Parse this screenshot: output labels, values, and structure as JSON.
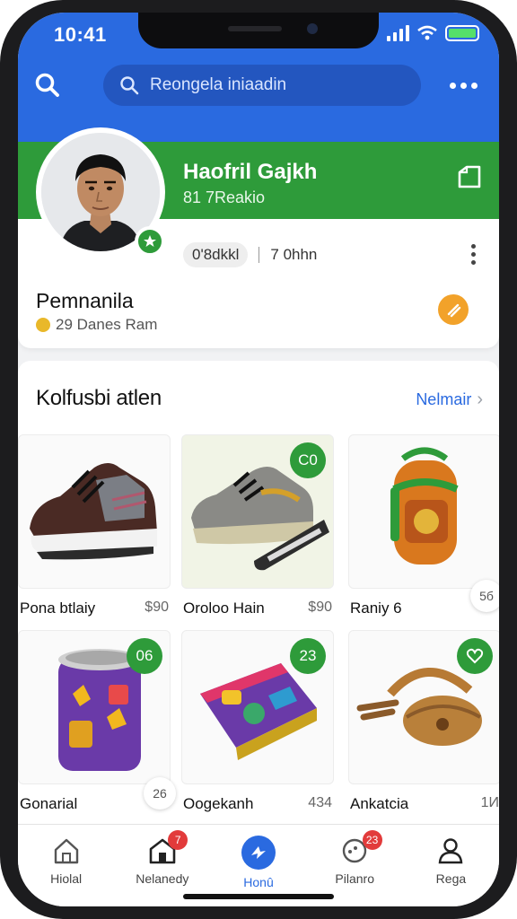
{
  "status": {
    "time": "10:41"
  },
  "header": {
    "search_placeholder": "Reongela iniaadin"
  },
  "profile": {
    "name": "Haofril Gajkh",
    "subtitle": "81 7Reakio",
    "stat_left": "0'8dkkl",
    "stat_right": "7 0hhn",
    "role": "Pemnanila",
    "members": "29 Danes Ram"
  },
  "section": {
    "title": "Kolfusbi atlen",
    "link": "Nelmair"
  },
  "products": [
    {
      "name": "Pona btlaiy",
      "price": "$90",
      "badge": "",
      "art": "shoe-brown"
    },
    {
      "name": "Oroloo Hain",
      "price": "$90",
      "badge": "C0",
      "art": "shoe-grey"
    },
    {
      "name": "Raniy 6",
      "price": "",
      "badge": "",
      "side": "5б",
      "art": "bag-orange"
    },
    {
      "name": "Gonarial",
      "price": "",
      "badge": "06",
      "side": "26",
      "art": "can-purple"
    },
    {
      "name": "Oogekanh",
      "price": "434",
      "badge": "23",
      "art": "bag-colorful"
    },
    {
      "name": "Ankatcia",
      "price": "1И",
      "badge": "",
      "art": "purse-brown"
    }
  ],
  "nav": [
    {
      "label": "Hiolal",
      "badge": ""
    },
    {
      "label": "Nelanedy",
      "badge": "7"
    },
    {
      "label": "Honû",
      "badge": "",
      "active": true
    },
    {
      "label": "Pilanro",
      "badge": "23"
    },
    {
      "label": "Rega",
      "badge": ""
    }
  ],
  "colors": {
    "primary_blue": "#2a6ae0",
    "brand_green": "#2e9b3a",
    "badge_red": "#e23b3b",
    "accent_orange": "#f2a22a"
  }
}
